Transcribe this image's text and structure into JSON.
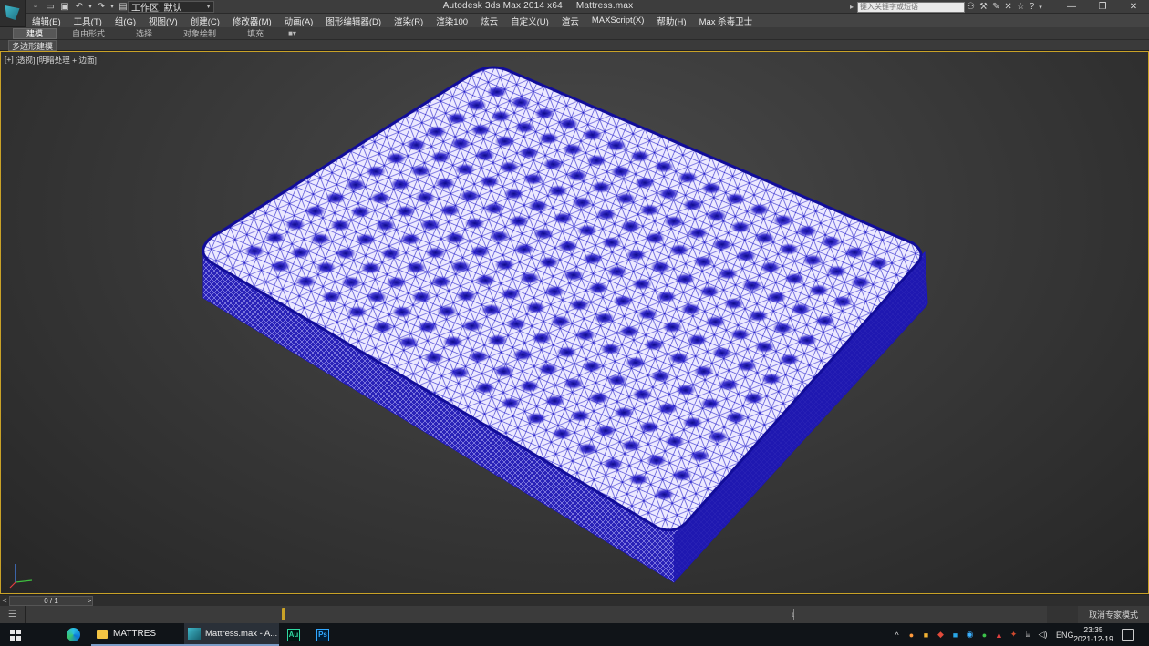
{
  "window": {
    "title": "Autodesk 3ds Max  2014 x64",
    "filename": "Mattress.max",
    "workspace": "工作区: 默认",
    "search_placeholder": "键入关键字或短语"
  },
  "menu": [
    "编辑(E)",
    "工具(T)",
    "组(G)",
    "视图(V)",
    "创建(C)",
    "修改器(M)",
    "动画(A)",
    "图形编辑器(D)",
    "渲染(R)",
    "渲染100",
    "炫云",
    "自定义(U)",
    "渲云",
    "MAXScript(X)",
    "帮助(H)",
    "Max 杀毒卫士"
  ],
  "ribbon": {
    "tabs": [
      "建模",
      "自由形式",
      "选择",
      "对象绘制",
      "填充"
    ],
    "active_tab": "建模",
    "sub_panel": "多边形建模"
  },
  "viewport": {
    "labels": [
      "[+]",
      "[透视]",
      "[明暗处理 + 边面]"
    ],
    "wire_color": "#1a14c8",
    "highlight_color": "#c9a227"
  },
  "timeslider": {
    "frame": "0 / 1",
    "prev": "<",
    "next": ">"
  },
  "trackbar": {
    "tick_label": "1",
    "expert_mode": "取消专家模式"
  },
  "taskbar": {
    "folder_label": "MATTRES",
    "max_label": "Mattress.max - A...",
    "au_label": "Au",
    "ps_label": "Ps",
    "lang": "ENG",
    "time": "23:35",
    "date": "2021-12-19"
  }
}
